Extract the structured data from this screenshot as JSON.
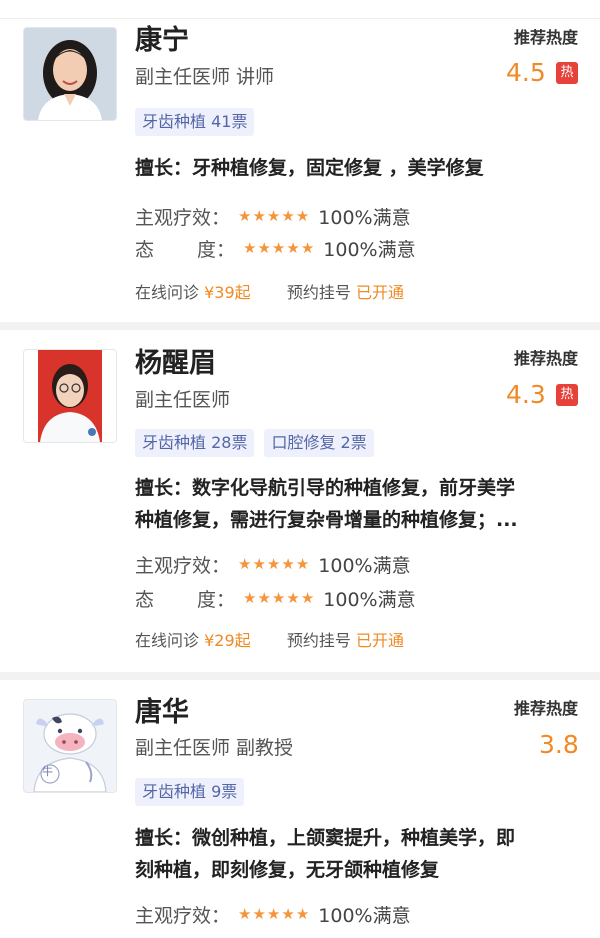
{
  "heat_label": "推荐热度",
  "expertise_prefix": "擅长：",
  "colors": {
    "accent": "#f08a24",
    "hot": "#e64239",
    "tag_bg": "#eef1fb",
    "tag_text": "#5566a8"
  },
  "doctors": [
    {
      "name": "康宁",
      "title": "副主任医师 讲师",
      "heat": "4.5",
      "hot_badge": "热",
      "tags": [
        "牙齿种植 41票"
      ],
      "expertise_line1": "牙种植修复，固定修复 ，美学修复",
      "expertise_line2": "",
      "rating_effect_label": "主观疗效：",
      "rating_effect_value": "100%满意",
      "rating_attitude_label_a": "态",
      "rating_attitude_label_b": "度：",
      "rating_attitude_value": "100%满意",
      "stars": 5,
      "consult_label": "在线问诊",
      "consult_price": "¥39起",
      "register_label": "预约挂号",
      "register_status": "已开通",
      "avatar": "female-doctor-photo"
    },
    {
      "name": "杨醒眉",
      "title": "副主任医师",
      "heat": "4.3",
      "hot_badge": "热",
      "tags": [
        "牙齿种植 28票",
        "口腔修复 2票"
      ],
      "expertise_line1": "数字化导航引导的种植修复，前牙美学",
      "expertise_line2": "种植修复，需进行复杂骨增量的种植修复；...",
      "rating_effect_label": "主观疗效：",
      "rating_effect_value": "100%满意",
      "rating_attitude_label_a": "态",
      "rating_attitude_label_b": "度：",
      "rating_attitude_value": "100%满意",
      "stars": 5,
      "consult_label": "在线问诊",
      "consult_price": "¥29起",
      "register_label": "预约挂号",
      "register_status": "已开通",
      "avatar": "female-doctor-id-photo"
    },
    {
      "name": "唐华",
      "title": "副主任医师 副教授",
      "heat": "3.8",
      "tags": [
        "牙齿种植 9票"
      ],
      "expertise_line1": "微创种植，上颌窦提升，种植美学，即",
      "expertise_line2": "刻种植，即刻修复，无牙颌种植修复",
      "rating_effect_label": "主观疗效：",
      "rating_effect_value": "100%满意",
      "stars": 5,
      "avatar": "cow-doctor-placeholder-icon",
      "avatar_badge": "牛"
    }
  ]
}
